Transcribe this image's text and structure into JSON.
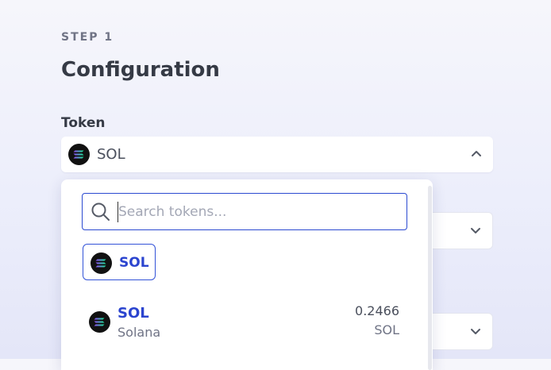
{
  "step": {
    "label": "STEP 1"
  },
  "page": {
    "title": "Configuration"
  },
  "token_field": {
    "label": "Token",
    "selected_symbol": "SOL",
    "icon": "solana-logo-icon",
    "expanded": true
  },
  "dropdown": {
    "search_placeholder": "Search tokens...",
    "search_value": "",
    "pinned_chips": [
      {
        "symbol": "SOL",
        "icon": "solana-logo-icon"
      }
    ],
    "tokens": [
      {
        "symbol": "SOL",
        "name": "Solana",
        "balance": "0.2466",
        "balance_unit": "SOL",
        "icon": "solana-logo-icon"
      }
    ]
  },
  "colors": {
    "accent": "#2b44cf",
    "search_border": "#2b4ad1",
    "heading": "#353a45",
    "muted": "#6f7385"
  }
}
